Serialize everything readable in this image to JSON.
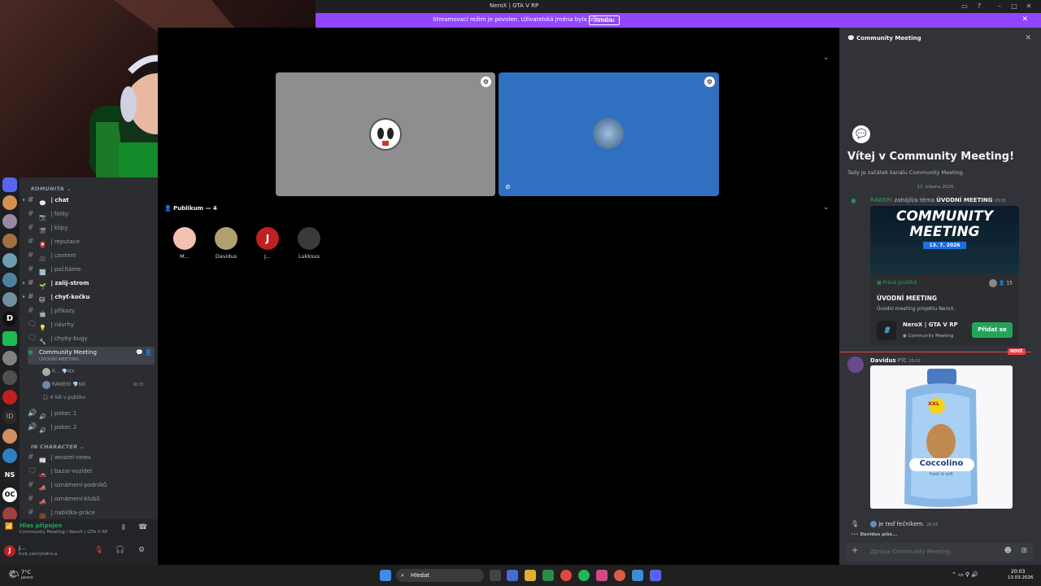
{
  "window": {
    "title": "NeroX | GTA V RP"
  },
  "banner": {
    "message": "Streamovací režim je povolen. Uživatelská jména byla oříznuta.",
    "button": "Zakázat"
  },
  "channels": {
    "category1": "KOMUNITA",
    "items": [
      {
        "name": "| chat",
        "bold": true,
        "arrow": true
      },
      {
        "name": "| fotky"
      },
      {
        "name": "| klipy"
      },
      {
        "name": "| reputace"
      },
      {
        "name": "| content"
      },
      {
        "name": "| počítáme"
      },
      {
        "name": "| zalij-strom",
        "bold": true,
        "arrow": true
      },
      {
        "name": "| chyť-kočku",
        "bold": true,
        "arrow": true
      },
      {
        "name": "| příkazy"
      },
      {
        "name": "| návrhy"
      },
      {
        "name": "| chyby-bugy"
      }
    ],
    "stage": {
      "name": "Community Meeting",
      "sub": "ÚVODNÍ MEETING"
    },
    "stage_users": [
      {
        "name": "R...",
        "tag": "NX"
      },
      {
        "name": "RAWERI",
        "tag": "NX"
      }
    ],
    "stage_listeners": "4 lidi v publiku",
    "voice": [
      "| pokec 1",
      "| pokec 2"
    ],
    "category2": "IN CHARACTER",
    "items2": [
      "| weazel-news",
      "| bazar-vozidel",
      "| oznámení-podniků",
      "| oznámení-klubů",
      "| nabídka-práce"
    ]
  },
  "voicebar": {
    "status": "Hlas připojen",
    "channel": "Community Meeting / NeroX | GTA V RP"
  },
  "user": {
    "name": "J...",
    "status": "kick.com/jindra-a"
  },
  "main": {
    "audience_title": "Publikum — 4",
    "audience": [
      "M...",
      "Davidus",
      "J...",
      "Lukksus"
    ]
  },
  "panel": {
    "header": "Community Meeting",
    "welcome_title": "Vítej v Community Meeting!",
    "welcome_sub": "Tady je začátek kanálu Community Meeting.",
    "date": "13. března 2026",
    "event_line_user": "RAWERI",
    "event_line_text": "zahájil/a téma",
    "event_line_topic": "ÚVODNÍ MEETING",
    "event_line_time": "20:01",
    "banner_l1": "COMMUNITY",
    "banner_l2": "MEETING",
    "banner_date": "13. 7. 2026",
    "live": "Právě probíhá",
    "listeners": "15",
    "event_title": "ÚVODNÍ MEETING",
    "event_desc": "Úvodní meeting projektu NeroX.",
    "server_name": "NeroX | GTA V RP",
    "server_channel": "Community Meeting",
    "join": "Přidat se",
    "new": "NOVÉ",
    "msg_user": "Davidus",
    "msg_tag": "PTC",
    "msg_time": "20:02",
    "product_brand": "Coccolino",
    "product_sub": "fresh & soft",
    "product_badge": "XXL",
    "speaker_text": "je teď řečníkem.",
    "speaker_time": "20:02",
    "typing": "Davidus píše...",
    "input_placeholder": "Zpráva Community Meeting"
  },
  "taskbar": {
    "weather_temp": "7°C",
    "weather_desc": "Jasno",
    "search": "Hledat",
    "time": "20:03",
    "date": "13.03.2026"
  }
}
